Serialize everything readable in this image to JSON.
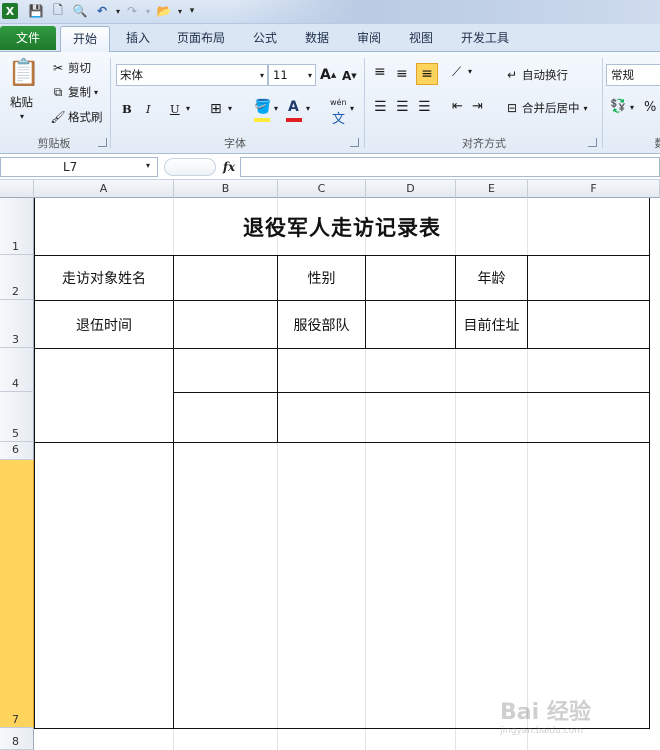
{
  "tabs": {
    "file": "文件",
    "home": "开始",
    "insert": "插入",
    "page_layout": "页面布局",
    "formulas": "公式",
    "data": "数据",
    "review": "审阅",
    "view": "视图",
    "developer": "开发工具"
  },
  "ribbon": {
    "clipboard": {
      "paste": "粘贴",
      "cut": "剪切",
      "copy": "复制",
      "format_painter": "格式刷",
      "label": "剪贴板"
    },
    "font": {
      "font_name": "宋体",
      "font_size": "11",
      "bold": "B",
      "italic": "I",
      "underline": "U",
      "grow": "A",
      "shrink": "A",
      "font_color": "A",
      "label": "字体",
      "phonetic": "wén"
    },
    "alignment": {
      "wrap_text": "自动换行",
      "merge_center": "合并后居中",
      "label": "对齐方式"
    },
    "number": {
      "format": "常规",
      "label": "数",
      "percent": "%"
    }
  },
  "formula_bar": {
    "name_box": "L7",
    "fx": "fx",
    "content": ""
  },
  "grid": {
    "columns": [
      "A",
      "B",
      "C",
      "D",
      "E",
      "F"
    ],
    "rows": [
      "1",
      "2",
      "3",
      "4",
      "5",
      "6",
      "7",
      "8"
    ],
    "selected_row": "6-7",
    "cells": {
      "title": "退役军人走访记录表",
      "visit_name_label": "走访对象姓名",
      "gender_label": "性别",
      "age_label": "年龄",
      "discharge_time_label": "退伍时间",
      "service_unit_label": "服役部队",
      "address_label": "目前住址"
    }
  },
  "watermark": {
    "text": "Bai 经验",
    "sub": "jingyan.baidu.com"
  },
  "colors": {
    "accent": "#1f7a2c",
    "selected_row": "#ffd45c",
    "ribbon": "#e2ebf6"
  }
}
